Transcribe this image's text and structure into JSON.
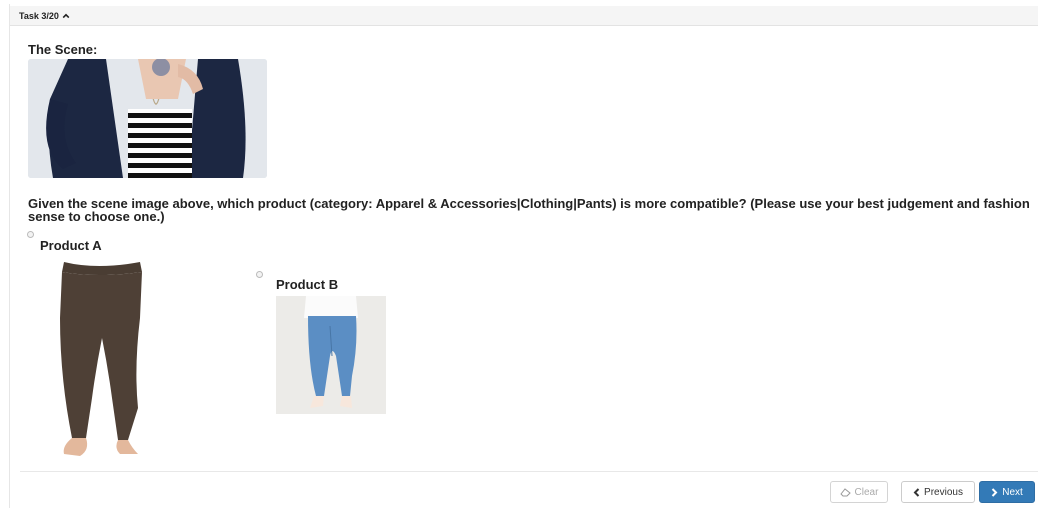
{
  "header": {
    "task_label": "Task 3/20"
  },
  "scene": {
    "label": "The Scene:",
    "image_icon": "scene-photo-striped-top-cardigan"
  },
  "question": {
    "text": "Given the scene image above, which product (category: Apparel & Accessories|Clothing|Pants) is more compatible? (Please use your best judgement and fashion sense to choose one.)"
  },
  "products": [
    {
      "label": "Product A",
      "image_icon": "brown-leggings-photo",
      "selected": false
    },
    {
      "label": "Product B",
      "image_icon": "blue-jeans-photo",
      "selected": false
    }
  ],
  "footer": {
    "clear_label": "Clear",
    "previous_label": "Previous",
    "next_label": "Next"
  },
  "colors": {
    "primary": "#337ab7",
    "header_bg": "#f5f5f5"
  }
}
